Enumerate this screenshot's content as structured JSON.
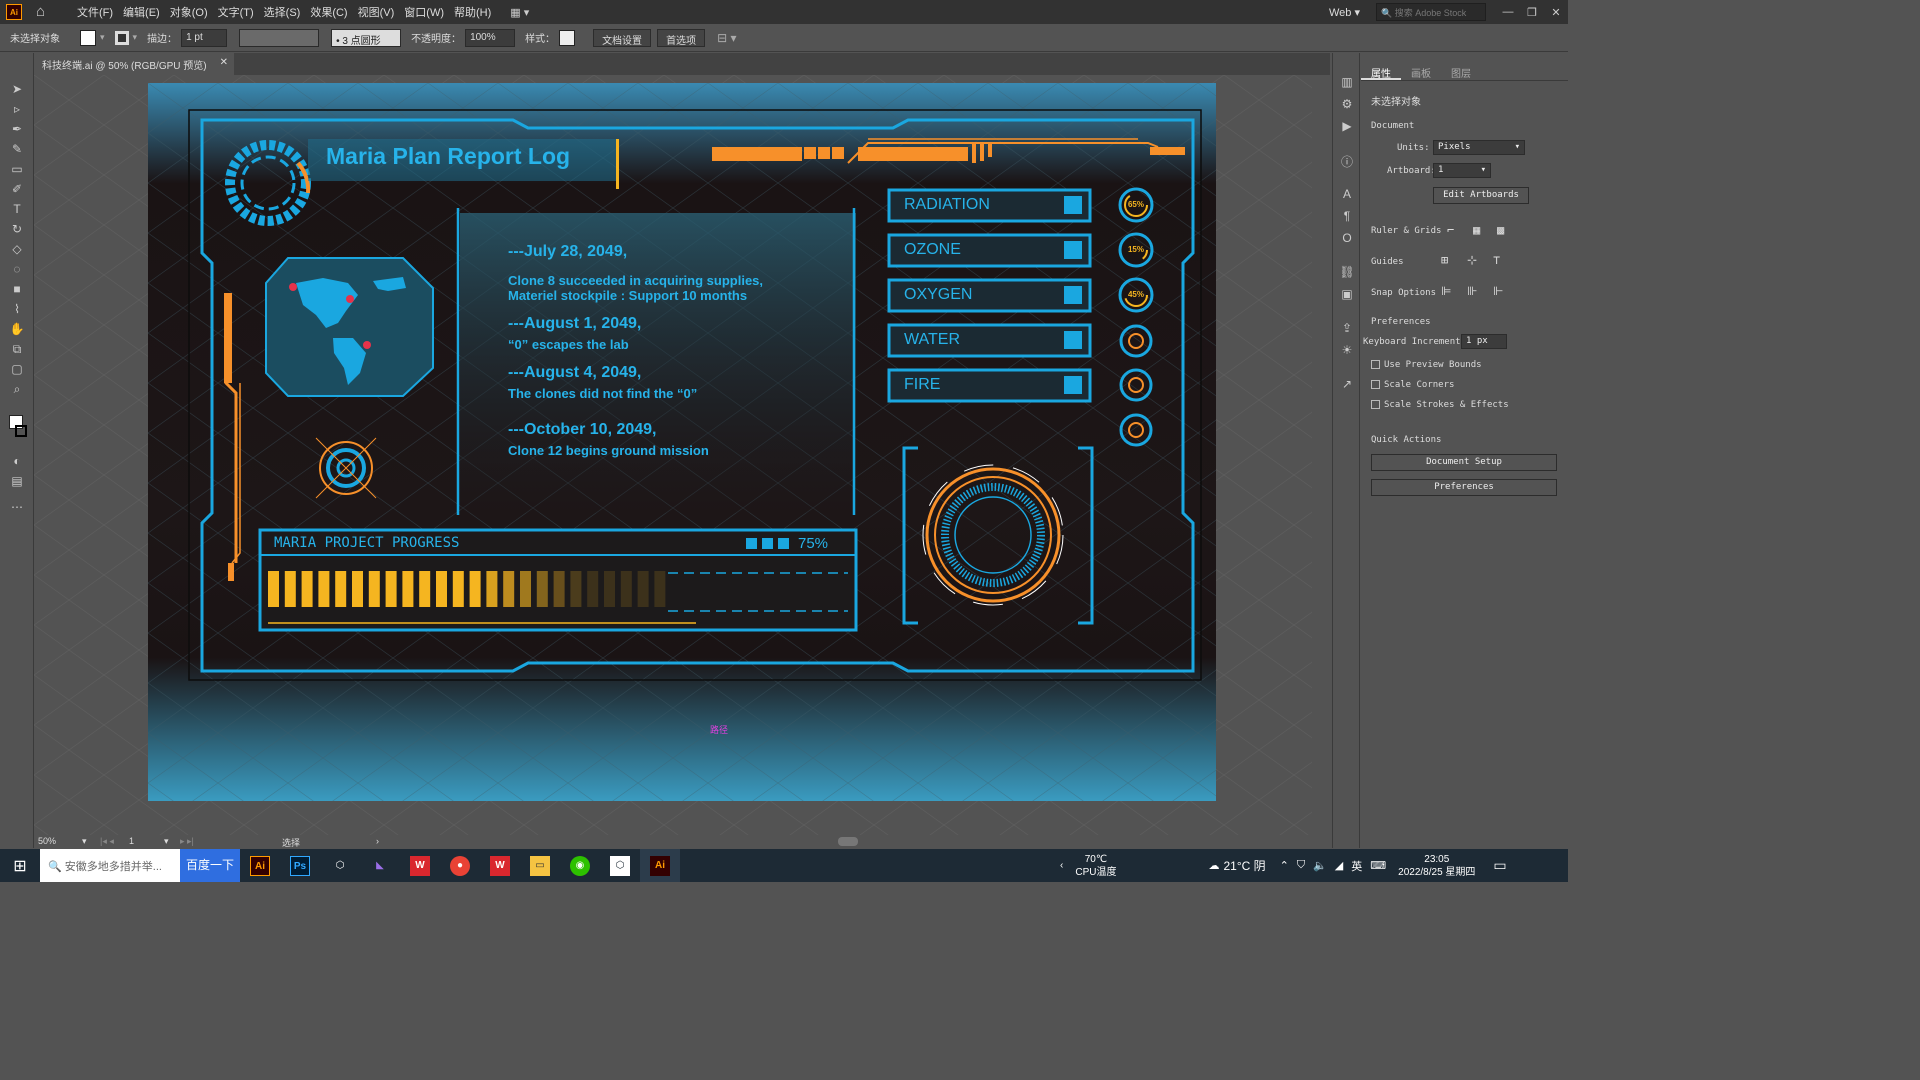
{
  "app": {
    "logo": "Ai",
    "menu": [
      "文件(F)",
      "编辑(E)",
      "对象(O)",
      "文字(T)",
      "选择(S)",
      "效果(C)",
      "视图(V)",
      "窗口(W)",
      "帮助(H)"
    ],
    "workspace": "Web",
    "stock_search_placeholder": "搜索 Adobe Stock"
  },
  "control_bar": {
    "selection": "未选择对象",
    "stroke_label": "描边：",
    "stroke_value": "1 pt",
    "brush_label": "• 3 点圆形",
    "opacity_label": "不透明度：",
    "opacity_value": "100%",
    "style_label": "样式：",
    "doc_setup": "文档设置",
    "preferences": "首选项"
  },
  "document_tab": "科技终端.ai @ 50% (RGB/GPU 预览)",
  "artwork": {
    "title": "Maria Plan Report Log",
    "log": [
      {
        "date": "---July 28, 2049,",
        "lines": [
          "Clone 8 succeeded in acquiring supplies,",
          "Materiel stockpile : Support 10 months"
        ]
      },
      {
        "date": "---August 1, 2049,",
        "lines": [
          "“0” escapes the lab"
        ]
      },
      {
        "date": "---August 4, 2049,",
        "lines": [
          "The clones did not find the “0”"
        ]
      },
      {
        "date": "---October 10, 2049,",
        "lines": [
          "Clone 12 begins ground mission"
        ]
      }
    ],
    "progress_label": "MARIA PROJECT PROGRESS",
    "progress_value": "75%",
    "progress_fraction": 0.75,
    "status_items": [
      "RADIATION",
      "OZONE",
      "OXYGEN",
      "WATER",
      "FIRE"
    ],
    "gauges": [
      "65%",
      "15%",
      "45%"
    ],
    "cursor_label": "路径",
    "colors": {
      "cyan": "#1aa7e0",
      "orange": "#f7902a",
      "yellow": "#f5b520"
    }
  },
  "status_bar": {
    "zoom": "50%",
    "artboard": "1",
    "tool": "选择"
  },
  "panel": {
    "tabs": [
      "属性",
      "画板",
      "图层"
    ],
    "no_selection": "未选择对象",
    "document_heading": "Document",
    "units_label": "Units:",
    "units_value": "Pixels",
    "artboard_label": "Artboard:",
    "artboard_value": "1",
    "edit_artboards": "Edit Artboards",
    "ruler_grids": "Ruler & Grids",
    "guides": "Guides",
    "snap_options": "Snap Options",
    "preferences_heading": "Preferences",
    "keyboard_increment_label": "Keyboard Increment:",
    "keyboard_increment_value": "1 px",
    "use_preview_bounds": "Use Preview Bounds",
    "scale_corners": "Scale Corners",
    "scale_strokes": "Scale Strokes & Effects",
    "quick_actions": "Quick Actions",
    "document_setup": "Document Setup",
    "preferences_btn": "Preferences"
  },
  "taskbar": {
    "search_placeholder": "安徽多地多措并举...",
    "search_button": "百度一下",
    "temp_cpu": "70℃",
    "cpu_label": "CPU温度",
    "weather": "21°C 阴",
    "ime": "英",
    "time": "23:05",
    "date": "2022/8/25 星期四"
  }
}
